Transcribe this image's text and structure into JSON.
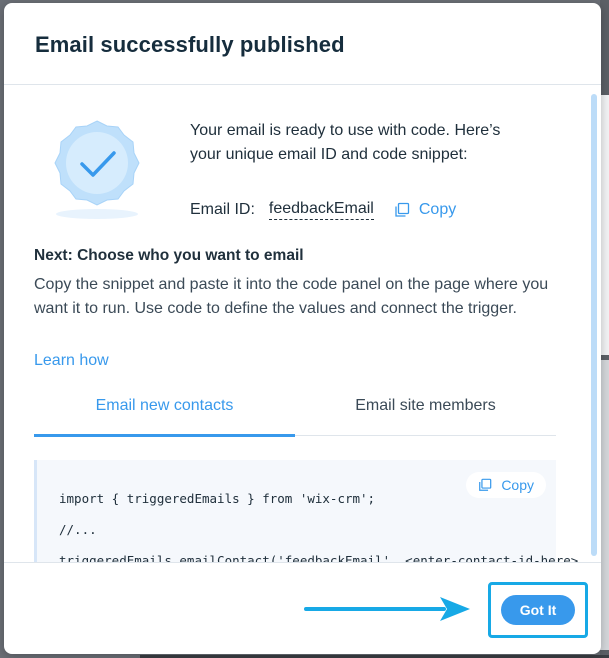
{
  "modal": {
    "title": "Email successfully published"
  },
  "intro": {
    "text": "Your email is ready to use with code. Here’s your unique email ID and code snippet:",
    "email_id_label": "Email ID:",
    "email_id_value": "feedbackEmail",
    "copy_label": "Copy"
  },
  "next": {
    "heading": "Next: Choose who you want to email",
    "description": "Copy the snippet and paste it into the code panel on the page where you want it to run. Use code to define the values and connect the trigger.",
    "learn_link": "Learn how"
  },
  "tabs": [
    {
      "label": "Email new contacts",
      "active": true
    },
    {
      "label": "Email site members",
      "active": false
    }
  ],
  "code": {
    "copy_label": "Copy",
    "lines": [
      "import { triggeredEmails } from 'wix-crm';",
      "//...",
      "triggeredEmails.emailContact('feedbackEmail', <enter-contact-id-here>"
    ]
  },
  "footer": {
    "got_it_label": "Got It"
  },
  "icons": {
    "badge": "check-badge-icon",
    "copy": "copy-icon",
    "arrow": "arrow-right-icon"
  },
  "colors": {
    "accent": "#3899ec",
    "highlight": "#17a9e6",
    "badge_fill": "#bfe0fb"
  }
}
